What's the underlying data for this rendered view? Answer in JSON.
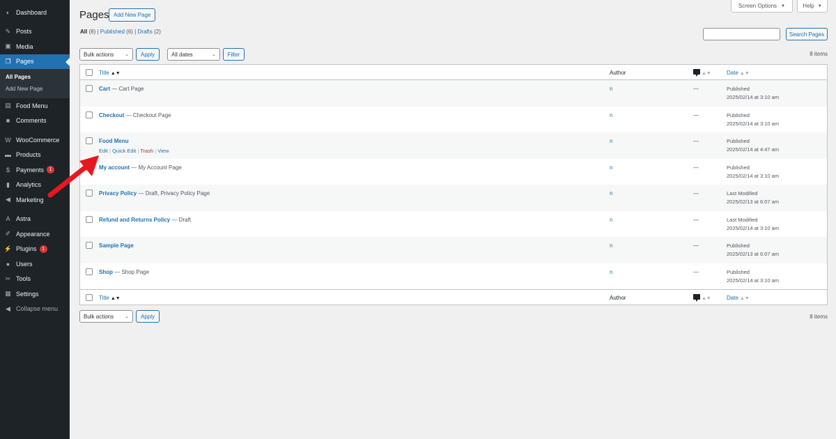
{
  "sidebar": {
    "items": [
      {
        "label": "Dashboard",
        "icon": "dashboard-icon",
        "glyph": "◐"
      },
      {
        "label": "Posts",
        "icon": "pushpin-icon",
        "glyph": "✎"
      },
      {
        "label": "Media",
        "icon": "media-icon",
        "glyph": "▣"
      },
      {
        "label": "Pages",
        "icon": "pages-icon",
        "glyph": "❐"
      },
      {
        "label": "Food Menu",
        "icon": "food-menu-icon",
        "glyph": "▤"
      },
      {
        "label": "Comments",
        "icon": "comments-icon",
        "glyph": "■"
      },
      {
        "label": "WooCommerce",
        "icon": "woocommerce-icon",
        "glyph": "W"
      },
      {
        "label": "Products",
        "icon": "products-icon",
        "glyph": "▬"
      },
      {
        "label": "Payments",
        "icon": "payments-icon",
        "glyph": "$",
        "badge": "1"
      },
      {
        "label": "Analytics",
        "icon": "analytics-icon",
        "glyph": "▮"
      },
      {
        "label": "Marketing",
        "icon": "megaphone-icon",
        "glyph": "◀"
      },
      {
        "label": "Astra",
        "icon": "astra-icon",
        "glyph": "A"
      },
      {
        "label": "Appearance",
        "icon": "brush-icon",
        "glyph": "✐"
      },
      {
        "label": "Plugins",
        "icon": "plugins-icon",
        "glyph": "⚡",
        "badge": "1"
      },
      {
        "label": "Users",
        "icon": "users-icon",
        "glyph": "●"
      },
      {
        "label": "Tools",
        "icon": "tools-icon",
        "glyph": "✂"
      },
      {
        "label": "Settings",
        "icon": "settings-icon",
        "glyph": "▦"
      },
      {
        "label": "Collapse menu",
        "icon": "collapse-icon",
        "glyph": "◀"
      }
    ],
    "submenu": [
      "All Pages",
      "Add New Page"
    ]
  },
  "header": {
    "screen_options": "Screen Options",
    "help": "Help",
    "title": "Pages",
    "add_new": "Add New Page"
  },
  "filters": {
    "all": "All",
    "all_count": "(8)",
    "published": "Published",
    "published_count": "(6)",
    "drafts": "Drafts",
    "drafts_count": "(2)",
    "search_button": "Search Pages",
    "bulk_actions": "Bulk actions",
    "apply": "Apply",
    "all_dates": "All dates",
    "filter": "Filter",
    "items_count": "8 items"
  },
  "table": {
    "headers": {
      "title": "Title",
      "author": "Author",
      "date": "Date"
    },
    "rows": [
      {
        "title": "Cart",
        "state": " — Cart Page",
        "author": "n",
        "comments": "—",
        "status": "Published",
        "date": "2025/02/14 at 3:10 am"
      },
      {
        "title": "Checkout",
        "state": " — Checkout Page",
        "author": "n",
        "comments": "—",
        "status": "Published",
        "date": "2025/02/14 at 3:10 am"
      },
      {
        "title": "Food Menu",
        "state": "",
        "author": "n",
        "comments": "—",
        "status": "Published",
        "date": "2025/02/14 at 4:47 am"
      },
      {
        "title": "My account",
        "state": " — My Account Page",
        "author": "n",
        "comments": "—",
        "status": "Published",
        "date": "2025/02/14 at 3:10 am"
      },
      {
        "title": "Privacy Policy",
        "state": " — Draft, Privacy Policy Page",
        "author": "n",
        "comments": "—",
        "status": "Last Modified",
        "date": "2025/02/13 at 6:07 am"
      },
      {
        "title": "Refund and Returns Policy",
        "state": " — Draft",
        "author": "n",
        "comments": "—",
        "status": "Last Modified",
        "date": "2025/02/14 at 3:10 am"
      },
      {
        "title": "Sample Page",
        "state": "",
        "author": "n",
        "comments": "—",
        "status": "Published",
        "date": "2025/02/13 at 6:07 am"
      },
      {
        "title": "Shop",
        "state": " — Shop Page",
        "author": "n",
        "comments": "—",
        "status": "Published",
        "date": "2025/02/14 at 3:10 am"
      }
    ],
    "row_actions": {
      "edit": "Edit",
      "quick_edit": "Quick Edit",
      "trash": "Trash",
      "view": "View",
      "sep": " | "
    }
  },
  "colors": {
    "accent": "#2271b1",
    "sidebar": "#1d2327",
    "annotation_arrow": "#e8171f",
    "trash": "#b32d2e"
  }
}
